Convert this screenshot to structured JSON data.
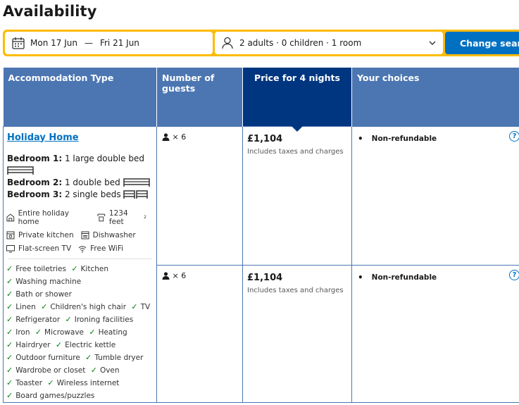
{
  "page_title": "Availability",
  "search": {
    "check_in": "Mon 17 Jun",
    "separator": "—",
    "check_out": "Fri 21 Jun",
    "guests": "2 adults · 0 children · 1 room",
    "button": "Change search"
  },
  "table": {
    "headers": {
      "accommodation": "Accommodation Type",
      "guests": "Number of guests",
      "price": "Price for 4 nights",
      "choices": "Your choices"
    }
  },
  "room": {
    "name": "Holiday Home",
    "bedrooms": [
      {
        "label": "Bedroom 1:",
        "beds": "1 large double bed"
      },
      {
        "label": "Bedroom 2:",
        "beds": "1 double bed"
      },
      {
        "label": "Bedroom 3:",
        "beds": "2 single beds"
      }
    ],
    "features": {
      "entire": "Entire holiday home",
      "size": "1234 feet",
      "size_sup": "2",
      "kitchen": "Private kitchen",
      "dishwasher": "Dishwasher",
      "tv": "Flat-screen TV",
      "wifi": "Free WiFi"
    },
    "amenities": [
      "Free toiletries",
      "Kitchen",
      "Washing machine",
      "Bath or shower",
      "Linen",
      "Children's high chair",
      "TV",
      "Refrigerator",
      "Ironing facilities",
      "Iron",
      "Microwave",
      "Heating",
      "Hairdryer",
      "Electric kettle",
      "Outdoor furniture",
      "Tumble dryer",
      "Wardrobe or closet",
      "Oven",
      "Toaster",
      "Wireless internet",
      "Board games/puzzles"
    ]
  },
  "options": [
    {
      "guests": "× 6",
      "price": "£1,104",
      "price_note": "Includes taxes and charges",
      "choice": "Non-refundable",
      "help": "?"
    },
    {
      "guests": "× 6",
      "price": "£1,104",
      "price_note": "Includes taxes and charges",
      "choice": "Non-refundable",
      "help": "?"
    }
  ],
  "colors": {
    "accent": "#0071c2",
    "header": "#4c76b2",
    "header_dark": "#003580",
    "search_border": "#febb02",
    "check": "#008009"
  },
  "icons": [
    "calendar-icon",
    "person-icon",
    "chevron-down-icon",
    "bed-icon",
    "house-icon",
    "size-icon",
    "kitchen-icon",
    "dishwasher-icon",
    "tv-icon",
    "wifi-icon",
    "check-icon",
    "guest-icon",
    "help-icon"
  ]
}
